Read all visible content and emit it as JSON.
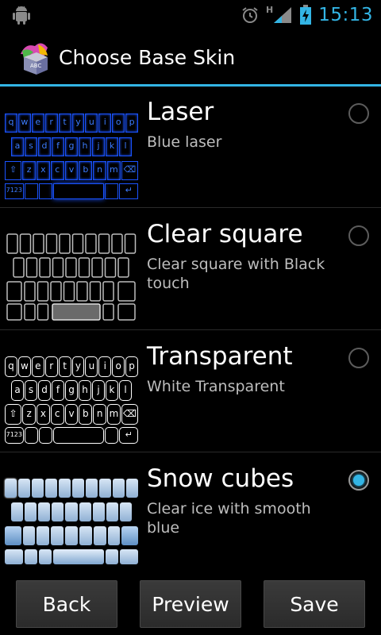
{
  "status_bar": {
    "time": "15:13",
    "network": "H",
    "icons": [
      "android-icon",
      "alarm-icon",
      "signal-icon",
      "battery-icon"
    ]
  },
  "header": {
    "title": "Choose Base Skin",
    "accent": "#33b5e5"
  },
  "skins": [
    {
      "title": "Laser",
      "subtitle": "Blue laser",
      "selected": false,
      "preview": "laser-keyboard"
    },
    {
      "title": "Clear square",
      "subtitle": "Clear square with Black touch",
      "selected": false,
      "preview": "clear-square-keyboard"
    },
    {
      "title": "Transparent",
      "subtitle": "White Transparent",
      "selected": false,
      "preview": "white-transparent-keyboard"
    },
    {
      "title": "Snow cubes",
      "subtitle": "Clear ice with smooth blue",
      "selected": true,
      "preview": "snow-cubes-keyboard"
    }
  ],
  "keyboard": {
    "row1": [
      "q",
      "w",
      "e",
      "r",
      "t",
      "y",
      "u",
      "i",
      "o",
      "p"
    ],
    "row2": [
      "a",
      "s",
      "d",
      "f",
      "g",
      "h",
      "j",
      "k",
      "l"
    ],
    "row3": [
      "z",
      "x",
      "c",
      "v",
      "b",
      "n",
      "m"
    ],
    "numkey": "7123"
  },
  "buttons": {
    "back": "Back",
    "preview": "Preview",
    "save": "Save"
  }
}
